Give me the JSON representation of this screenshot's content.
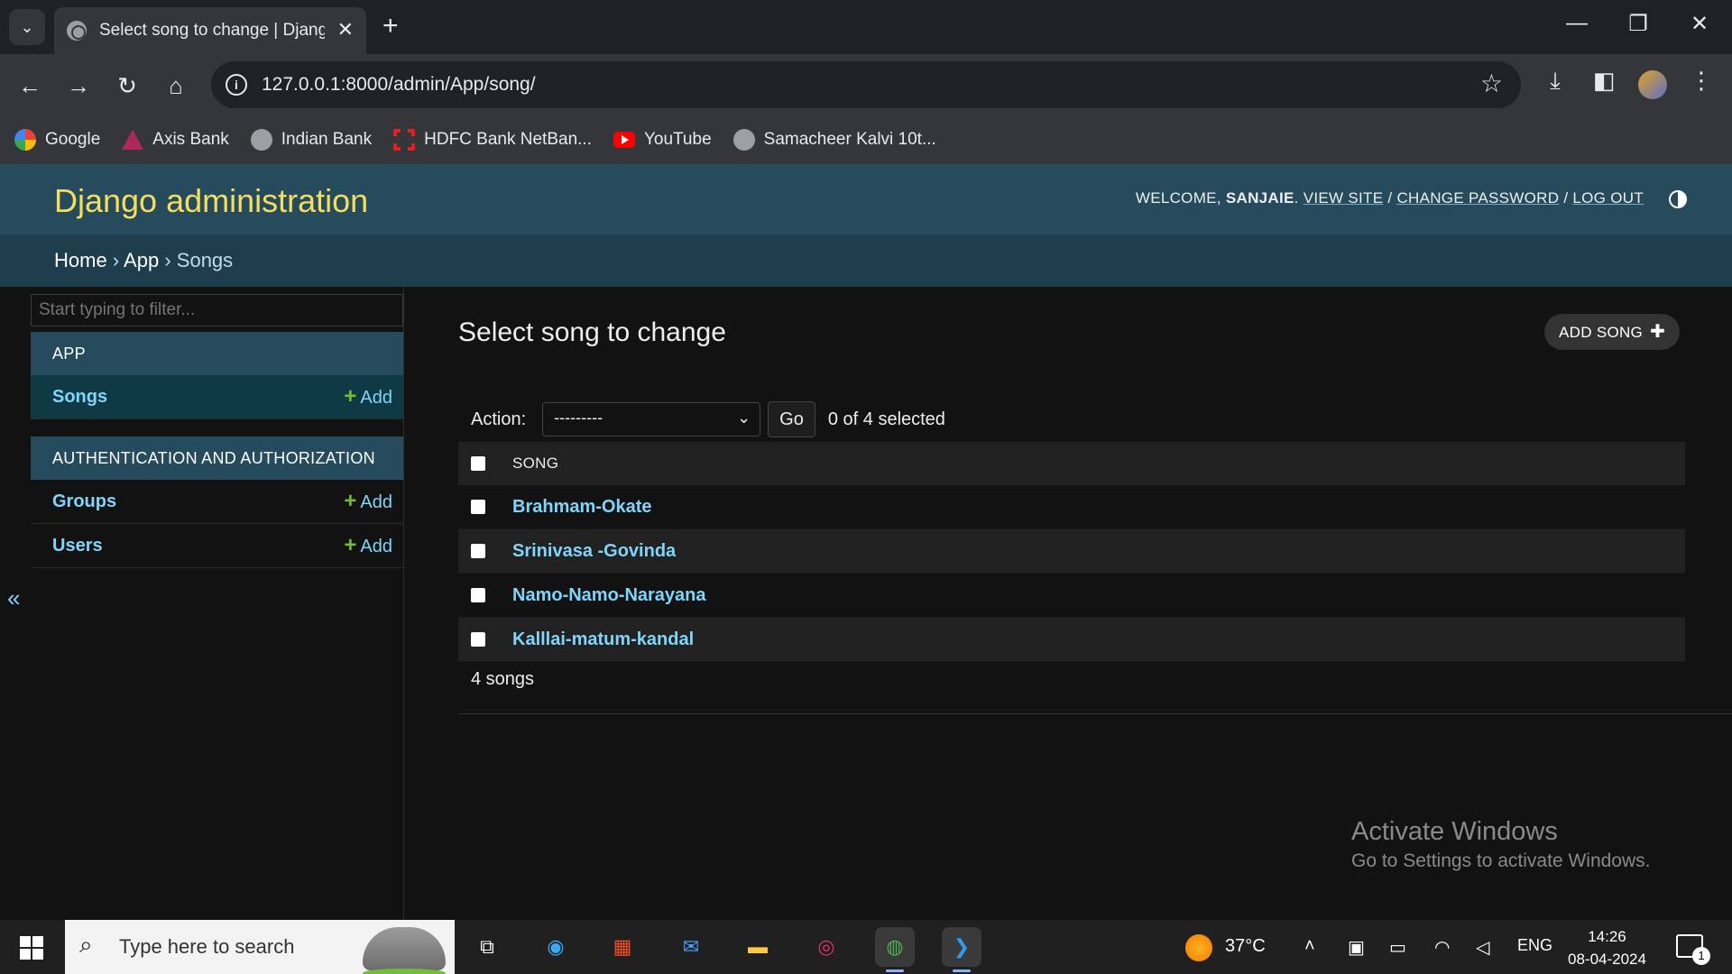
{
  "browser": {
    "tab_title": "Select song to change | Django",
    "url": "127.0.0.1:8000/admin/App/song/",
    "bookmarks": [
      "Google",
      "Axis Bank",
      "Indian Bank",
      "HDFC Bank NetBan...",
      "YouTube",
      "Samacheer Kalvi 10t..."
    ]
  },
  "admin": {
    "brand": "Django administration",
    "welcome": "Welcome,",
    "username": "Sanjaie",
    "view_site": "View site",
    "change_password": "Change password",
    "log_out": "Log out",
    "breadcrumbs": {
      "home": "Home",
      "app": "App",
      "current": "Songs",
      "sep": "›"
    }
  },
  "sidebar": {
    "filter_placeholder": "Start typing to filter...",
    "modules": [
      {
        "caption": "APP",
        "models": [
          {
            "name": "Songs",
            "add": "Add"
          }
        ]
      },
      {
        "caption": "AUTHENTICATION AND AUTHORIZATION",
        "models": [
          {
            "name": "Groups",
            "add": "Add"
          },
          {
            "name": "Users",
            "add": "Add"
          }
        ]
      }
    ],
    "collapse": "«"
  },
  "content": {
    "title": "Select song to change",
    "add_button": "Add song",
    "action_label": "Action:",
    "action_selected": "---------",
    "go": "Go",
    "counter": "0 of 4 selected",
    "column": "Song",
    "songs": [
      "Brahmam-Okate",
      "Srinivasa -Govinda",
      "Namo-Namo-Narayana",
      "Kalllai-matum-kandal"
    ],
    "paginator": "4 songs"
  },
  "watermark": {
    "line1": "Activate Windows",
    "line2": "Go to Settings to activate Windows."
  },
  "taskbar": {
    "search_placeholder": "Type here to search",
    "weather": "37°C",
    "language": "ENG",
    "time": "14:26",
    "date": "08-04-2024",
    "notifications": "1"
  }
}
